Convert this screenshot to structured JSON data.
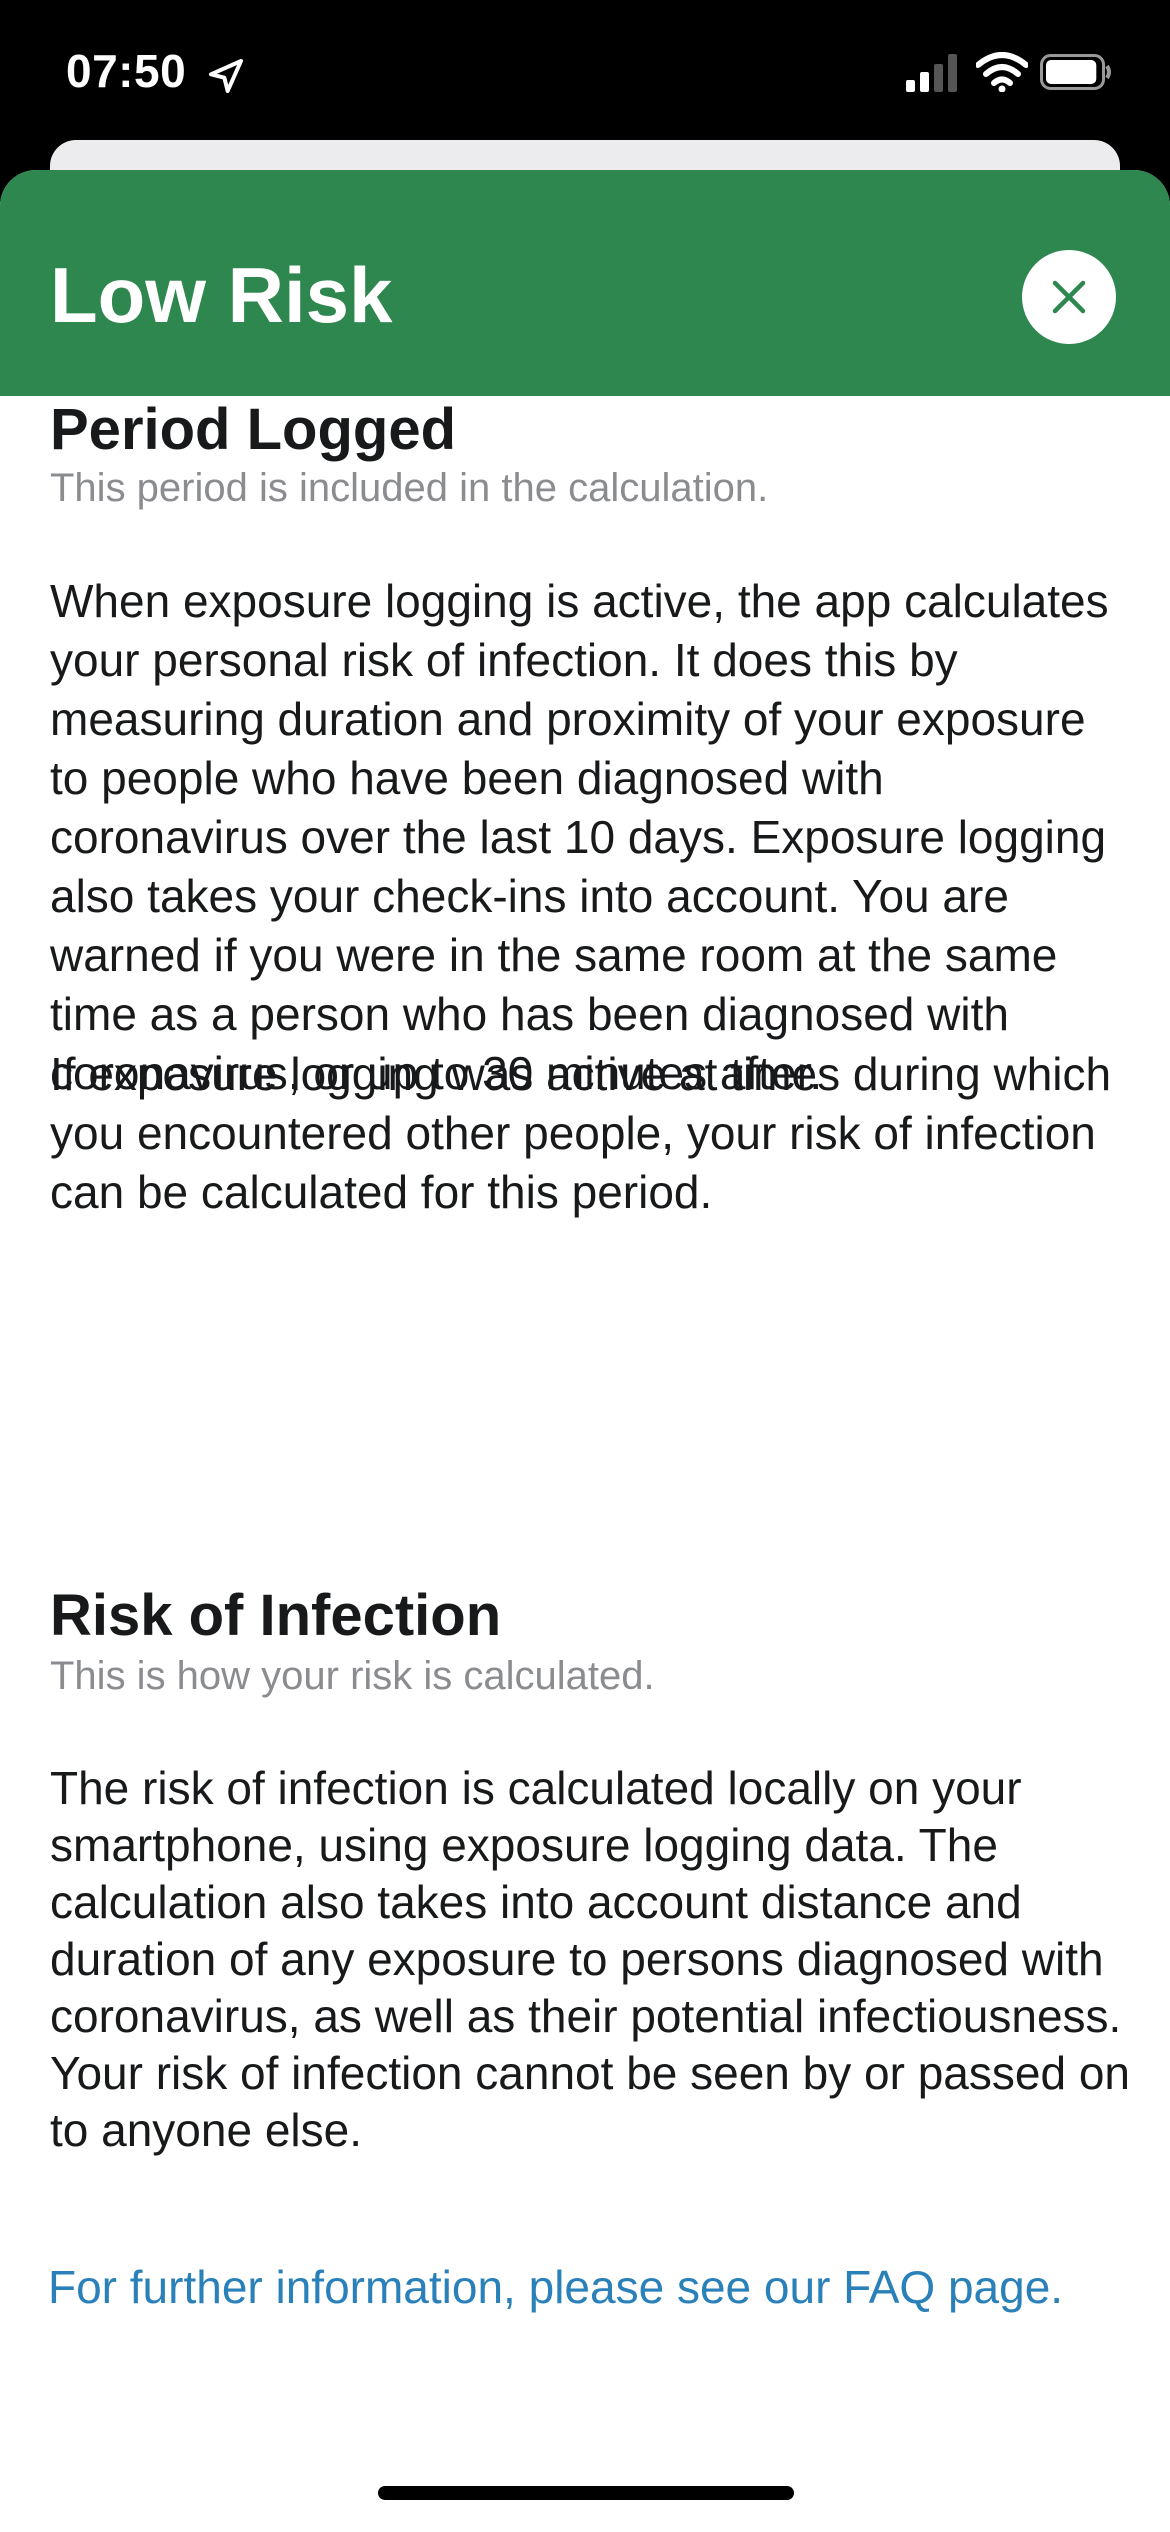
{
  "status_bar": {
    "time": "07:50",
    "location_icon": "location-arrow-icon",
    "signal_icon": "cellular-signal-icon",
    "wifi_icon": "wifi-icon",
    "battery_icon": "battery-icon",
    "battery_level": 0.95
  },
  "header": {
    "title": "Low Risk",
    "close_icon": "close-icon",
    "color": "#2e874f"
  },
  "sections": [
    {
      "title": "Period Logged",
      "subtitle": "This period is included in the calculation.",
      "paragraphs": [
        "When exposure logging is active, the app calculates your personal risk of infection. It does this by measuring duration and proximity of your exposure to people who have been diagnosed with coronavirus over the last 10 days. Exposure logging also takes your check-ins into account. You are warned if you were in the same room at the same time as a person who has been diagnosed with coronavirus, or up to 30 minutes after.",
        "If exposure logging was active at times during which you encountered other people, your risk of infection can be calculated for this period."
      ]
    },
    {
      "title": "Risk of Infection",
      "subtitle": "This is how your risk is calculated.",
      "paragraphs": [
        "The risk of infection is calculated locally on your smartphone, using exposure logging data. The calculation also takes into account distance and duration of any exposure to persons diagnosed with coronavirus, as well as their potential infectiousness. Your risk of infection cannot be seen by or passed on to anyone else."
      ]
    }
  ],
  "faq_link": "For further information, please see our FAQ page.",
  "colors": {
    "link": "#2a80b9",
    "text": "#17191a",
    "subtitle": "#8a8c8f"
  }
}
